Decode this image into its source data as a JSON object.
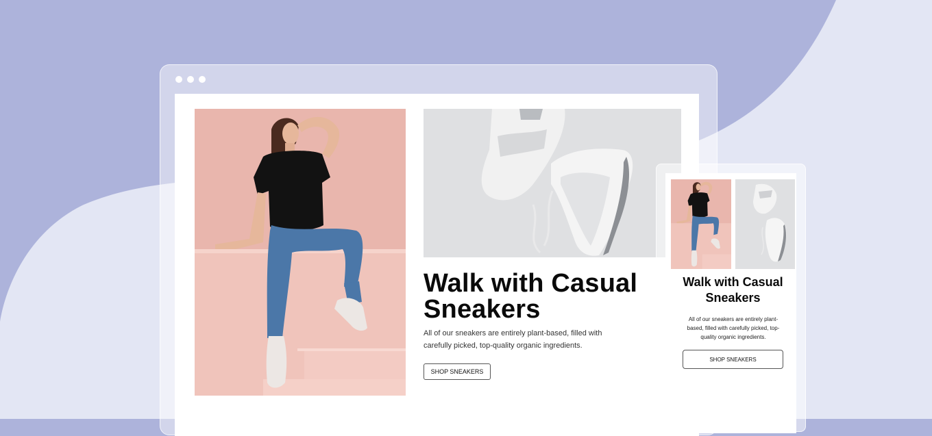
{
  "colors": {
    "background": "#adb3db",
    "wave": "#e3e6f4",
    "hero_backdrop": "#e9b6ad",
    "shoe_backdrop": "#dfe0e2",
    "text": "#0a0a0a"
  },
  "desktop": {
    "window_controls": [
      "dot",
      "dot",
      "dot"
    ],
    "hero_image": "woman-sitting-on-pink-steps-photo",
    "shoe_image": "white-sneakers-photo",
    "title": "Walk with Casual Sneakers",
    "description": "All of our sneakers are entirely plant-based, filled with carefully picked, top-quality organic ingredients.",
    "cta_label": "SHOP SNEAKERS"
  },
  "mobile": {
    "hero_image": "woman-sitting-on-pink-steps-photo",
    "shoe_image": "white-sneakers-photo",
    "title": "Walk with Casual Sneakers",
    "description": "All of our sneakers are entirely plant-based, filled with carefully picked, top-quality organic ingredients.",
    "cta_label": "SHOP SNEAKERS"
  }
}
